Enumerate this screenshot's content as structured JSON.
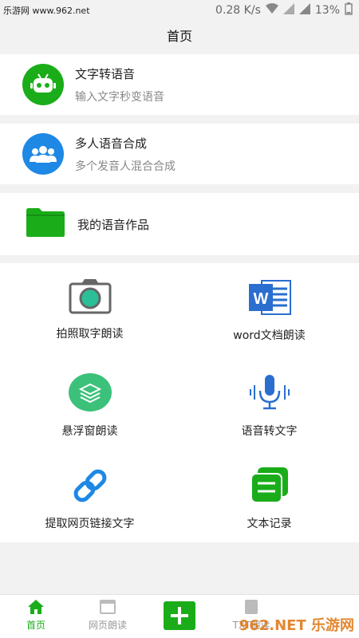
{
  "status": {
    "watermark": "乐游网 www.962.net",
    "speed": "0.28 K/s",
    "battery": "13%"
  },
  "header": {
    "title": "首页"
  },
  "features": [
    {
      "title": "文字转语音",
      "subtitle": "输入文字秒变语音",
      "icon": "robot-icon",
      "color": "#1aad19"
    },
    {
      "title": "多人语音合成",
      "subtitle": "多个发音人混合合成",
      "icon": "people-icon",
      "color": "#1e88e5"
    }
  ],
  "works": {
    "label": "我的语音作品",
    "icon": "folder-icon"
  },
  "grid": [
    {
      "label": "拍照取字朗读",
      "icon": "camera-icon"
    },
    {
      "label": "word文档朗读",
      "icon": "word-icon"
    },
    {
      "label": "悬浮窗朗读",
      "icon": "layers-icon"
    },
    {
      "label": "语音转文字",
      "icon": "microphone-icon"
    },
    {
      "label": "提取网页链接文字",
      "icon": "link-icon"
    },
    {
      "label": "文本记录",
      "icon": "notes-icon"
    }
  ],
  "tabbar": {
    "home": "首页",
    "web": "网页朗读",
    "txt": "TXT朗读"
  },
  "watermark_br": "962.NET 乐游网",
  "colors": {
    "accent": "#1aad19",
    "blue": "#1e88e5"
  }
}
